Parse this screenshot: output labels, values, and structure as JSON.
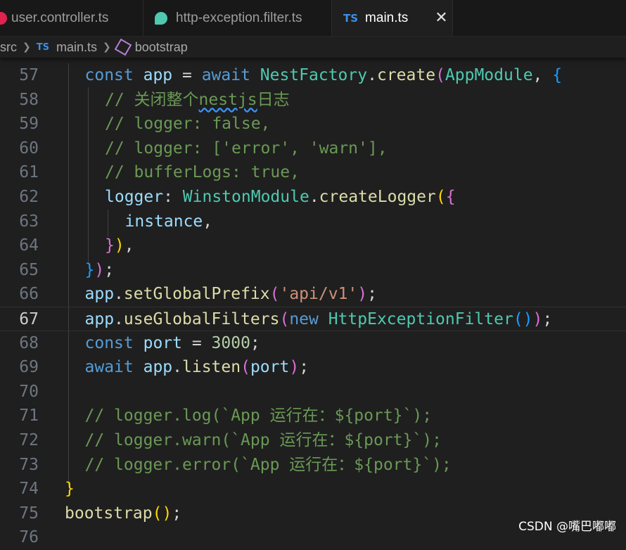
{
  "tabs": [
    {
      "label": "user.controller.ts",
      "icon": "nest-icon",
      "active": false
    },
    {
      "label": "http-exception.filter.ts",
      "icon": "nest-icon",
      "active": false
    },
    {
      "label": "main.ts",
      "icon": "ts-icon",
      "badge": "TS",
      "active": true
    }
  ],
  "close_glyph": "✕",
  "breadcrumb": {
    "folder": "src",
    "file_badge": "TS",
    "file": "main.ts",
    "symbol": "bootstrap"
  },
  "editor": {
    "current_line": 67,
    "lines": [
      {
        "n": "57",
        "tokens": [
          [
            "kw",
            "const "
          ],
          [
            "var",
            "app"
          ],
          [
            "plain",
            " = "
          ],
          [
            "kw",
            "await "
          ],
          [
            "cls",
            "NestFactory"
          ],
          [
            "plain",
            "."
          ],
          [
            "fn",
            "create"
          ],
          [
            "b2",
            "("
          ],
          [
            "cls",
            "AppModule"
          ],
          [
            "plain",
            ", "
          ],
          [
            "b3",
            "{"
          ]
        ]
      },
      {
        "n": "58",
        "tokens": [
          [
            "cm",
            "// 关闭整个"
          ],
          [
            "cm squig",
            "nestjs"
          ],
          [
            "cm",
            "日志"
          ]
        ]
      },
      {
        "n": "59",
        "tokens": [
          [
            "cm",
            "// logger: false,"
          ]
        ]
      },
      {
        "n": "60",
        "tokens": [
          [
            "cm",
            "// logger: ['error', 'warn'],"
          ]
        ]
      },
      {
        "n": "61",
        "tokens": [
          [
            "cm",
            "// bufferLogs: true,"
          ]
        ]
      },
      {
        "n": "62",
        "tokens": [
          [
            "var",
            "logger"
          ],
          [
            "plain",
            ": "
          ],
          [
            "cls",
            "WinstonModule"
          ],
          [
            "plain",
            "."
          ],
          [
            "fn",
            "createLogger"
          ],
          [
            "b1",
            "("
          ],
          [
            "b2",
            "{"
          ]
        ]
      },
      {
        "n": "63",
        "tokens": [
          [
            "var",
            "instance"
          ],
          [
            "plain",
            ","
          ]
        ]
      },
      {
        "n": "64",
        "tokens": [
          [
            "b2",
            "}"
          ],
          [
            "b1",
            ")"
          ],
          [
            "plain",
            ","
          ]
        ]
      },
      {
        "n": "65",
        "tokens": [
          [
            "b3",
            "}"
          ],
          [
            "b2",
            ")"
          ],
          [
            "plain",
            ";"
          ]
        ]
      },
      {
        "n": "66",
        "tokens": [
          [
            "var",
            "app"
          ],
          [
            "plain",
            "."
          ],
          [
            "fn",
            "setGlobalPrefix"
          ],
          [
            "b2",
            "("
          ],
          [
            "str",
            "'api/v1'"
          ],
          [
            "b2",
            ")"
          ],
          [
            "plain",
            ";"
          ]
        ]
      },
      {
        "n": "67",
        "tokens": [
          [
            "var",
            "app"
          ],
          [
            "plain",
            "."
          ],
          [
            "fn",
            "useGlobalFilters"
          ],
          [
            "b2",
            "("
          ],
          [
            "kw",
            "new "
          ],
          [
            "cls",
            "HttpExceptionFilter"
          ],
          [
            "b3",
            "()"
          ],
          [
            "b2",
            ")"
          ],
          [
            "plain",
            ";"
          ]
        ]
      },
      {
        "n": "68",
        "tokens": [
          [
            "kw",
            "const "
          ],
          [
            "var",
            "port"
          ],
          [
            "plain",
            " = "
          ],
          [
            "num",
            "3000"
          ],
          [
            "plain",
            ";"
          ]
        ]
      },
      {
        "n": "69",
        "tokens": [
          [
            "kw",
            "await "
          ],
          [
            "var",
            "app"
          ],
          [
            "plain",
            "."
          ],
          [
            "fn",
            "listen"
          ],
          [
            "b2",
            "("
          ],
          [
            "var",
            "port"
          ],
          [
            "b2",
            ")"
          ],
          [
            "plain",
            ";"
          ]
        ]
      },
      {
        "n": "70",
        "tokens": []
      },
      {
        "n": "71",
        "tokens": [
          [
            "cm",
            "// logger.log(`App 运行在：${port}`);"
          ]
        ]
      },
      {
        "n": "72",
        "tokens": [
          [
            "cm",
            "// logger.warn(`App 运行在：${port}`);"
          ]
        ]
      },
      {
        "n": "73",
        "tokens": [
          [
            "cm",
            "// logger.error(`App 运行在：${port}`);"
          ]
        ]
      },
      {
        "n": "74",
        "tokens": [
          [
            "b1",
            "}"
          ]
        ]
      },
      {
        "n": "75",
        "tokens": [
          [
            "fn",
            "bootstrap"
          ],
          [
            "b1",
            "()"
          ],
          [
            "plain",
            ";"
          ]
        ]
      },
      {
        "n": "76",
        "tokens": []
      }
    ]
  },
  "watermark": "CSDN @嘴巴嘟嘟",
  "colors": {
    "background": "#1f1f1f",
    "keyword": "#569cd6",
    "comment": "#6a9955",
    "string": "#ce9178",
    "class": "#4ec9b0",
    "function": "#dcdcaa"
  }
}
